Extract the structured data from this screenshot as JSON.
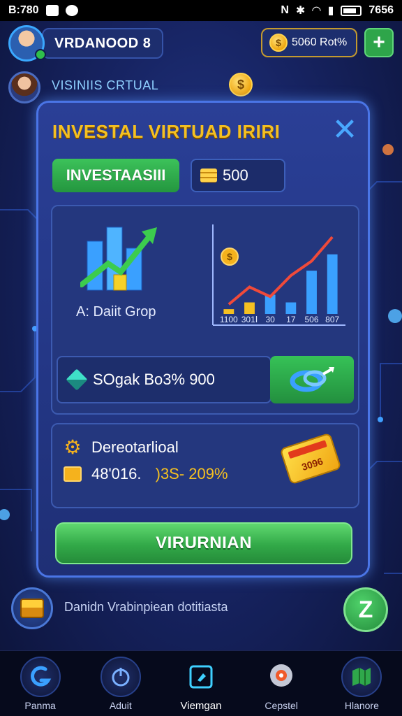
{
  "status_bar": {
    "time": "B:780",
    "right_time": "7656"
  },
  "header": {
    "username": "VRDANOOD 8",
    "balance": "5060 Rot%",
    "subtitle": "VISINIIS CRTUAL"
  },
  "modal": {
    "title": "INVESTAL VIRTUAD IRIRI",
    "invest_button": "INVESTAASIII",
    "amount": "500",
    "chart_caption": "A: Daiit Grop",
    "profit_text": "SOgak Bo3% 900",
    "info_label": "Dereotarlioal",
    "info_value_1": "48'016.",
    "info_value_2": ")3S- 209%",
    "ticket_text": "3096",
    "confirm_button": "VIRURNIAN"
  },
  "chart_data": {
    "type": "bar",
    "categories": [
      "1100",
      "301Ⅰ",
      "30",
      "17",
      "506",
      "807"
    ],
    "values": [
      5,
      12,
      20,
      12,
      45,
      62
    ],
    "trend_line": [
      10,
      28,
      18,
      40,
      55,
      80
    ],
    "xlabel": "",
    "ylabel": "",
    "colors": {
      "bars": "#3aa0ff",
      "trend": "#f04a3a",
      "small_bars": "#f5c021"
    }
  },
  "footer": {
    "hint": "Danidn Vrabinpiean dotitiasta",
    "z_button": "Z"
  },
  "bottom_nav": {
    "items": [
      {
        "label": "Panma",
        "icon": "swirl-icon"
      },
      {
        "label": "Aduit",
        "icon": "power-icon"
      },
      {
        "label": "Viemgan",
        "icon": "tag-icon"
      },
      {
        "label": "Cepstel",
        "icon": "robot-icon"
      },
      {
        "label": "Hlanore",
        "icon": "map-icon"
      }
    ]
  },
  "colors": {
    "accent_gold": "#f5c021",
    "accent_green": "#32a948",
    "accent_blue": "#4a75e6",
    "background": "#172463"
  }
}
